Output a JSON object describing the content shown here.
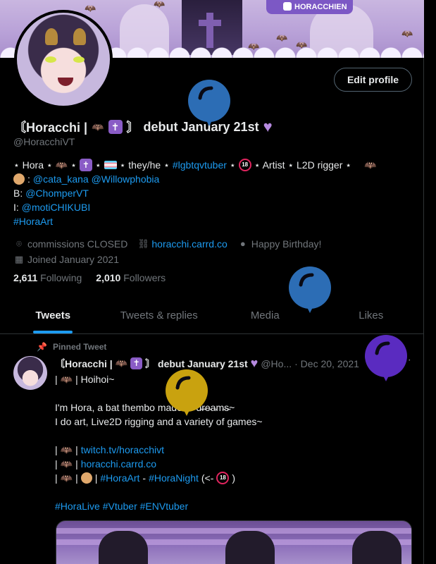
{
  "banner": {
    "tag": "HORACCHIEN"
  },
  "profile": {
    "edit_button": "Edit profile",
    "name_prefix": "〘Horacchi |",
    "name_sep": "〙",
    "name_debut": "debut January 21st",
    "handle": "@HoracchiVT",
    "bio": {
      "line1_parts": [
        "⋆ Hora ⋆",
        "⋆",
        "⋆",
        "⋆ they/he ⋆"
      ],
      "line1_tag": "#lgbtqvtuber",
      "line1_after": "⋆ Artist ⋆ L2D rigger ⋆",
      "line2_prefix": ":",
      "line2_links": "@cata_kana @Willowphobia",
      "line3_label": "B:",
      "line3_link": "@ChomperVT",
      "line4_label": "I:",
      "line4_link": "@motiCHIKUBI",
      "line5_tag": "#HoraArt"
    },
    "meta": {
      "location": "commissions CLOSED",
      "website": "horacchi.carrd.co",
      "birthday": "Happy Birthday!",
      "joined": "Joined January 2021"
    },
    "following_count": "2,611",
    "following_label": "Following",
    "followers_count": "2,010",
    "followers_label": "Followers"
  },
  "tabs": [
    "Tweets",
    "Tweets & replies",
    "Media",
    "Likes"
  ],
  "tweet": {
    "pinned_label": "Pinned Tweet",
    "author_prefix": "〘Horacchi |",
    "author_debut": "〙 debut January 21st",
    "handle": "@Ho...",
    "date": "· Dec 20, 2021",
    "more": "···",
    "greeting": "| Hoihoi~",
    "line1": "I'm Hora, a bat thembo made of",
    "line1_word": "d̴r̴e̴a̴m̴s̴~",
    "line2": "I do art, Live2D rigging and a variety of games~",
    "link_twitch": "twitch.tv/horacchivt",
    "link_carrd": "horacchi.carrd.co",
    "art_tag": "#HoraArt",
    "dash": "-",
    "night_tag": "#HoraNight",
    "night_suffix_open": "(<-",
    "night_suffix_close": ")",
    "hashtags": "#HoraLive #Vtuber #ENVtuber"
  },
  "icons": {
    "location": "pin-icon",
    "link": "link-icon",
    "birthday": "balloon-icon",
    "calendar": "calendar-icon",
    "pin": "pin-icon"
  },
  "colors": {
    "accent": "#1d9bf0",
    "balloon_blue": "#2c6db5",
    "balloon_gold": "#c9a20f",
    "balloon_purple": "#5a2bc0",
    "heart": "#b68ae0"
  }
}
